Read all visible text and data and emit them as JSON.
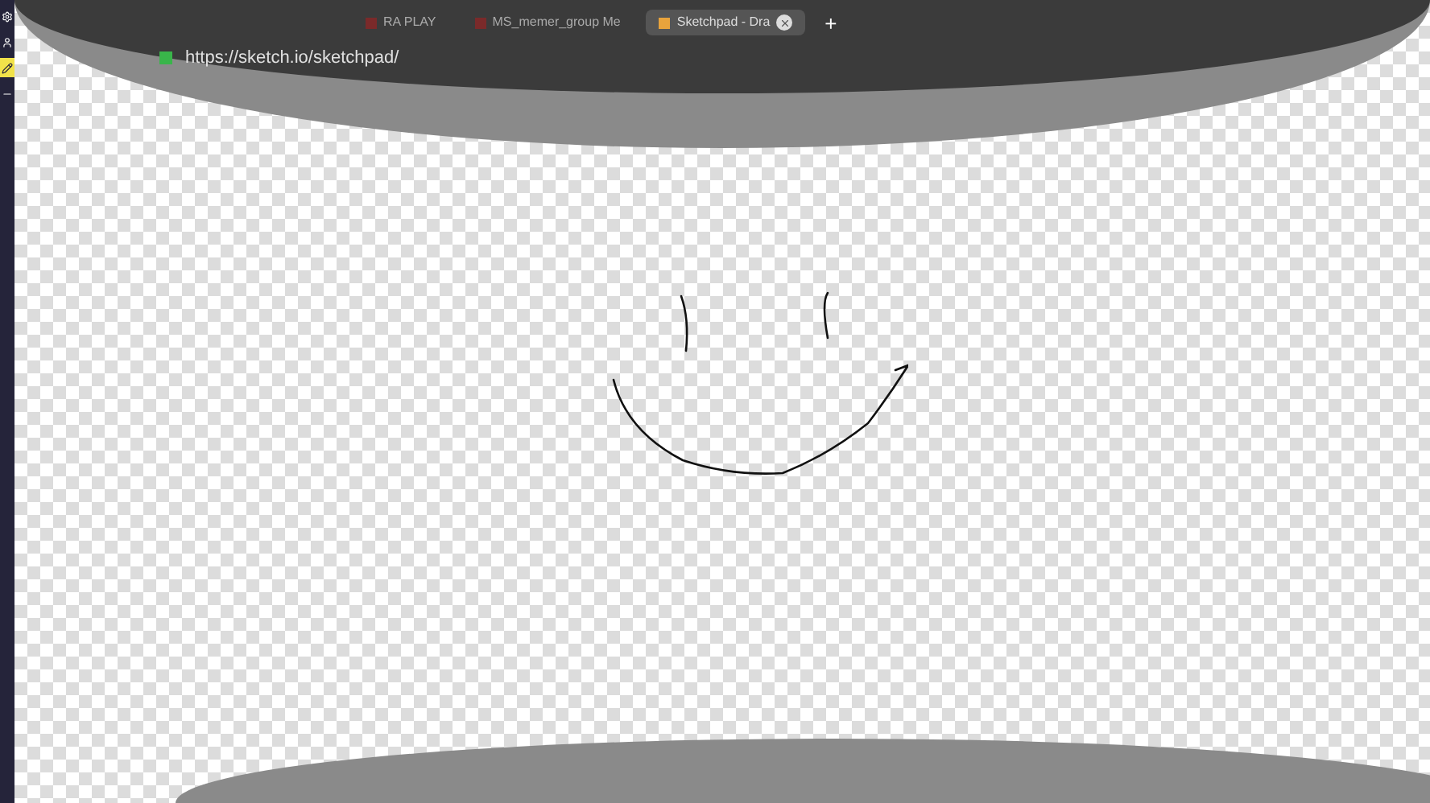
{
  "sidebar": {
    "tools": [
      {
        "kind": "gear",
        "selected": false
      },
      {
        "kind": "person",
        "selected": false
      },
      {
        "kind": "pencil",
        "selected": true
      },
      {
        "kind": "dash",
        "selected": false
      }
    ]
  },
  "browser": {
    "tabs": [
      {
        "label": "RA PLAY",
        "selected": false
      },
      {
        "label": "MS_memer_group Me",
        "selected": false
      },
      {
        "label": "Sketchpad - Dra",
        "selected": true
      }
    ],
    "new_tab": "+",
    "address": "https://sketch.io/sketchpad/"
  }
}
